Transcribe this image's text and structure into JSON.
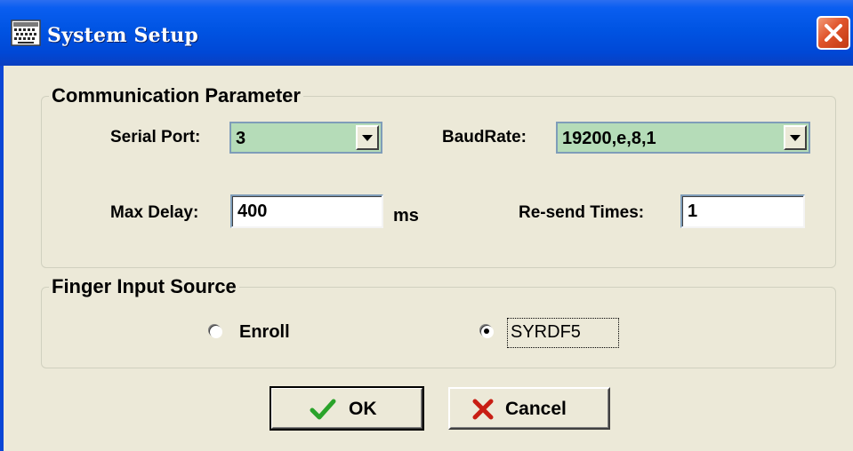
{
  "window": {
    "title": "System Setup",
    "icon": "app-icon",
    "close_icon": "close-icon"
  },
  "communication": {
    "legend": "Communication Parameter",
    "serial_port_label": "Serial Port:",
    "serial_port_value": "3",
    "baudrate_label": "BaudRate:",
    "baudrate_value": "19200,e,8,1",
    "max_delay_label": "Max Delay:",
    "max_delay_value": "400",
    "max_delay_unit": "ms",
    "resend_label": "Re-send Times:",
    "resend_value": "1"
  },
  "finger": {
    "legend": "Finger Input Source",
    "options": [
      {
        "label": "Enroll",
        "selected": false
      },
      {
        "label": "SYRDF5",
        "selected": true
      }
    ]
  },
  "buttons": {
    "ok_label": "OK",
    "ok_icon": "checkmark-icon",
    "cancel_label": "Cancel",
    "cancel_icon": "x-icon"
  },
  "colors": {
    "titlebar": "#0054e3",
    "dialog_bg": "#ece9d8",
    "combo_bg": "#b5dcb8",
    "close_button": "#e0542b",
    "ok_icon": "#2aa32a",
    "cancel_icon": "#c81e14"
  }
}
